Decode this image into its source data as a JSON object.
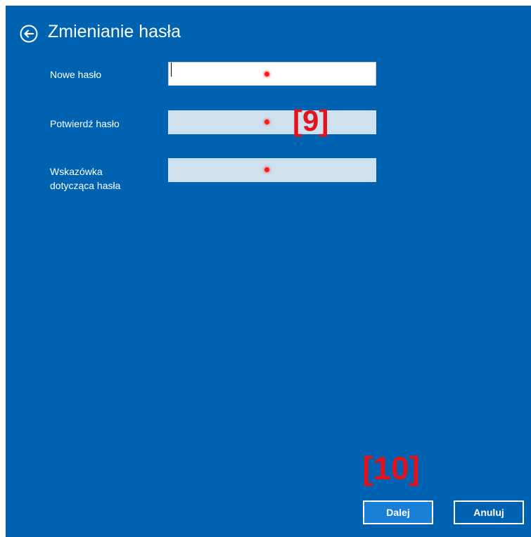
{
  "dialog": {
    "title": "Zmienianie hasła"
  },
  "fields": {
    "new_password": {
      "label": "Nowe hasło",
      "value": ""
    },
    "confirm_password": {
      "label": "Potwierdź hasło",
      "value": ""
    },
    "hint": {
      "label_line1": "Wskazówka",
      "label_line2": "dotycząca hasła",
      "value": ""
    }
  },
  "buttons": {
    "next": "Dalej",
    "cancel": "Anuluj"
  },
  "annotations": {
    "marker_9": "[9]",
    "marker_10": "[10]"
  },
  "colors": {
    "background": "#0063B1",
    "primary_button": "#1a7fd6",
    "marker": "#e0141e",
    "inactive_field": "#cfe0ef"
  },
  "icons": {
    "back": "arrow-left-circle"
  }
}
